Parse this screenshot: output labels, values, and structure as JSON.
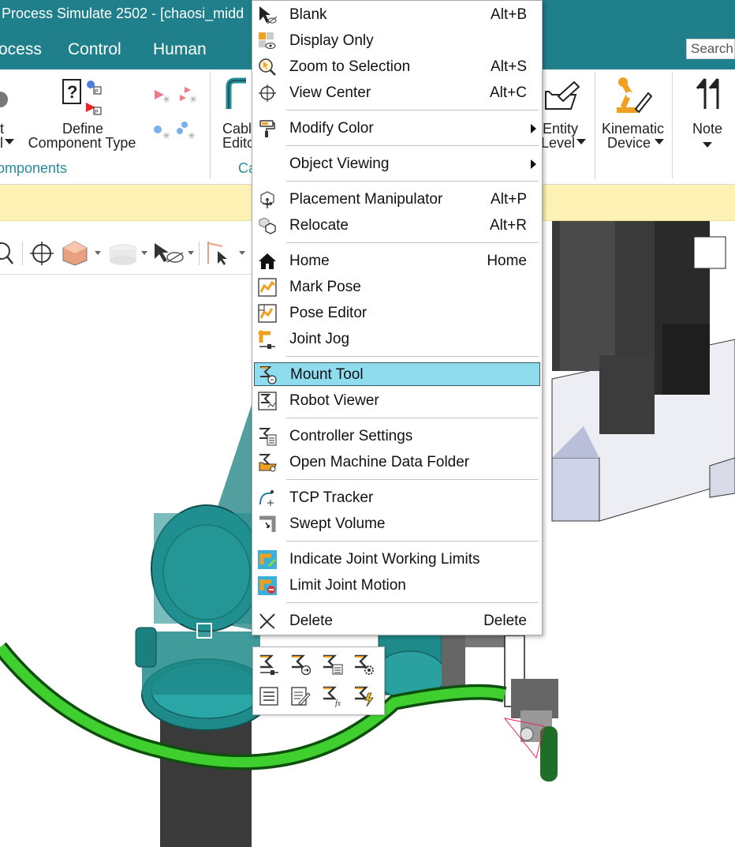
{
  "window": {
    "title": "Process Simulate 2502 - [chaosi_midd"
  },
  "menubar": {
    "tabs": [
      "ocess",
      "Control",
      "Human"
    ],
    "search_placeholder": "Search"
  },
  "ribbon": {
    "items": {
      "left_partial_line1": "t",
      "left_partial_line2": "l",
      "define_component_type_line1": "Define",
      "define_component_type_line2": "Component Type",
      "cable_editor_line1": "Cabl",
      "cable_editor_line2": "Edito",
      "entity_level_line1": "Entity",
      "entity_level_line2": "Level",
      "kinematic_device_line1": "Kinematic",
      "kinematic_device_line2": "Device",
      "note": "Note"
    },
    "groups": {
      "components": "omponents",
      "cable_partial": "Ca"
    }
  },
  "context_menu": {
    "items": [
      {
        "label": "Blank",
        "shortcut": "Alt+B",
        "icon": "blank-icon"
      },
      {
        "label": "Display Only",
        "shortcut": "",
        "icon": "display-only-icon"
      },
      {
        "label": "Zoom to Selection",
        "shortcut": "Alt+S",
        "icon": "zoom-selection-icon"
      },
      {
        "label": "View Center",
        "shortcut": "Alt+C",
        "icon": "view-center-icon"
      },
      {
        "label": "Modify Color",
        "shortcut": "",
        "icon": "modify-color-icon",
        "submenu": true
      },
      {
        "label": "Object Viewing",
        "shortcut": "",
        "icon": "",
        "submenu": true
      },
      {
        "label": "Placement Manipulator",
        "shortcut": "Alt+P",
        "icon": "placement-manipulator-icon"
      },
      {
        "label": "Relocate",
        "shortcut": "Alt+R",
        "icon": "relocate-icon"
      },
      {
        "label": "Home",
        "shortcut": "Home",
        "icon": "home-icon"
      },
      {
        "label": "Mark Pose",
        "shortcut": "",
        "icon": "mark-pose-icon"
      },
      {
        "label": "Pose Editor",
        "shortcut": "",
        "icon": "pose-editor-icon"
      },
      {
        "label": "Joint Jog",
        "shortcut": "",
        "icon": "joint-jog-icon"
      },
      {
        "label": "Mount Tool",
        "shortcut": "",
        "icon": "mount-tool-icon",
        "highlighted": true
      },
      {
        "label": "Robot Viewer",
        "shortcut": "",
        "icon": "robot-viewer-icon"
      },
      {
        "label": "Controller Settings",
        "shortcut": "",
        "icon": "controller-settings-icon"
      },
      {
        "label": "Open Machine Data Folder",
        "shortcut": "",
        "icon": "machine-data-folder-icon"
      },
      {
        "label": "TCP Tracker",
        "shortcut": "",
        "icon": "tcp-tracker-icon"
      },
      {
        "label": "Swept Volume",
        "shortcut": "",
        "icon": "swept-volume-icon"
      },
      {
        "label": "Indicate Joint Working Limits",
        "shortcut": "",
        "icon": "joint-limits-icon"
      },
      {
        "label": "Limit Joint Motion",
        "shortcut": "",
        "icon": "limit-joint-motion-icon"
      },
      {
        "label": "Delete",
        "shortcut": "Delete",
        "icon": "delete-icon"
      }
    ]
  },
  "colors": {
    "title_band": "#1f7f8a",
    "menu_highlight": "#8fdcef",
    "info_bar": "#fdf2b3",
    "robot_teal": "#1f8f8f",
    "cable_green": "#3fcf2f",
    "accent_orange": "#f0a020"
  }
}
